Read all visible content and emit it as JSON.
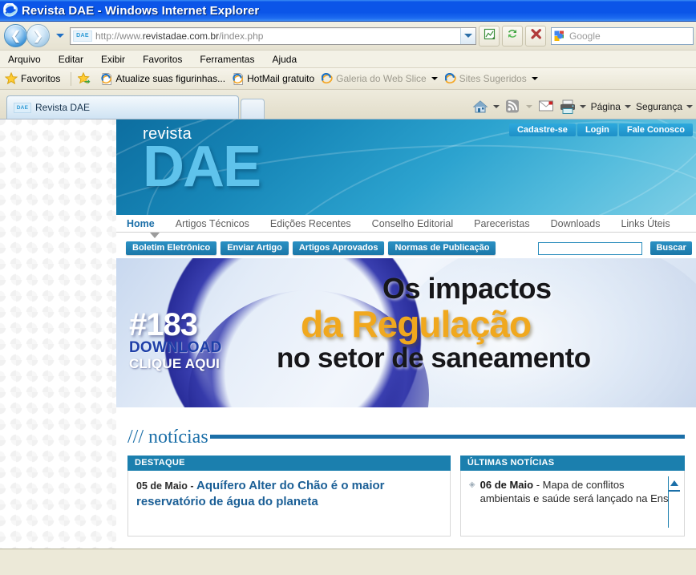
{
  "window": {
    "title": "Revista DAE - Windows Internet Explorer",
    "ie_icon": "internet-explorer-icon"
  },
  "addressbar": {
    "back_icon": "back-arrow-icon",
    "forward_icon": "forward-arrow-icon",
    "recent_icon": "recent-pages-dropdown-icon",
    "site_badge": "DAE",
    "url_protocol": "http://www.",
    "url_domain": "revistadae.com.br",
    "url_path": "/index.php",
    "url_full": "http://www.revistadae.com.br/index.php",
    "dropdown_icon": "chevron-down-icon",
    "compat_icon": "compatibility-view-icon",
    "refresh_icon": "refresh-icon",
    "stop_icon": "stop-icon",
    "search_engine": "Google",
    "search_placeholder": "Google",
    "search_value": ""
  },
  "menubar": {
    "items": [
      {
        "label": "Arquivo"
      },
      {
        "label": "Editar"
      },
      {
        "label": "Exibir"
      },
      {
        "label": "Favoritos"
      },
      {
        "label": "Ferramentas"
      },
      {
        "label": "Ajuda"
      }
    ]
  },
  "favoritesbar": {
    "favorites_label": "Favoritos",
    "favorites_icon": "star-icon",
    "add_icon": "add-to-favorites-icon",
    "items": [
      {
        "label": "Atualize suas figurinhas...",
        "icon": "ie-page-icon",
        "dim": false,
        "caret": false
      },
      {
        "label": "HotMail gratuito",
        "icon": "ie-page-icon",
        "dim": false,
        "caret": false
      },
      {
        "label": "Galeria do Web Slice",
        "icon": "ie-page-icon",
        "dim": true,
        "caret": true
      },
      {
        "label": "Sites Sugeridos",
        "icon": "ie-page-icon",
        "dim": true,
        "caret": true
      }
    ]
  },
  "tabbar": {
    "tabs": [
      {
        "label": "Revista DAE",
        "badge": "DAE",
        "active": true
      }
    ],
    "new_tab_icon": "new-tab-icon",
    "tools": [
      {
        "label": "",
        "icon": "home-icon",
        "caret": true
      },
      {
        "label": "",
        "icon": "rss-feeds-icon",
        "caret": true
      },
      {
        "label": "",
        "icon": "read-mail-icon",
        "caret": false
      },
      {
        "label": "",
        "icon": "print-icon",
        "caret": true
      },
      {
        "label": "Página",
        "icon": "",
        "caret": true
      },
      {
        "label": "Segurança",
        "icon": "",
        "caret": true
      }
    ]
  },
  "site": {
    "logo": {
      "sub": "revista",
      "main": "DAE"
    },
    "top_buttons": [
      {
        "label": "Cadastre-se"
      },
      {
        "label": "Login"
      },
      {
        "label": "Fale Conosco"
      }
    ],
    "nav": [
      {
        "label": "Home",
        "active": true
      },
      {
        "label": "Artigos Técnicos",
        "active": false
      },
      {
        "label": "Edições Recentes",
        "active": false
      },
      {
        "label": "Conselho Editorial",
        "active": false
      },
      {
        "label": "Pareceristas",
        "active": false
      },
      {
        "label": "Downloads",
        "active": false
      },
      {
        "label": "Links Úteis",
        "active": false
      }
    ],
    "actions": [
      {
        "label": "Boletim Eletrônico"
      },
      {
        "label": "Enviar Artigo"
      },
      {
        "label": "Artigos Aprovados"
      },
      {
        "label": "Normas de Publicação"
      }
    ],
    "search": {
      "value": "",
      "placeholder": "",
      "button_label": "Buscar"
    },
    "hero": {
      "issue_number": "#183",
      "download_label": "DOWNLOAD",
      "click_label": "CLIQUE AQUI",
      "line1": "Os impactos",
      "line2": "da Regulação",
      "line3": "no setor de saneamento"
    },
    "news": {
      "section_title": "/// notícias",
      "destaque": {
        "header": "DESTAQUE",
        "date": "05 de Maio",
        "separator": " - ",
        "title": "Aquífero Alter do Chão é o maior reservatório de água do planeta"
      },
      "ultimas": {
        "header": "ÚLTIMAS NOTÍCIAS",
        "items": [
          {
            "bullet": "◈",
            "date": "06 de Maio",
            "separator": " - ",
            "text": "Mapa de conflitos ambientais e saúde será lançado na Ensp"
          }
        ],
        "scroll_up_icon": "scroll-up-arrow-icon"
      }
    }
  },
  "colors": {
    "titlebar_blue": "#0b55e8",
    "site_teal": "#1787b8",
    "panel_header": "#1b7fae",
    "link_blue": "#1b5f96",
    "hero_gold": "#f0a81e",
    "chrome_beige": "#ece9d8"
  }
}
